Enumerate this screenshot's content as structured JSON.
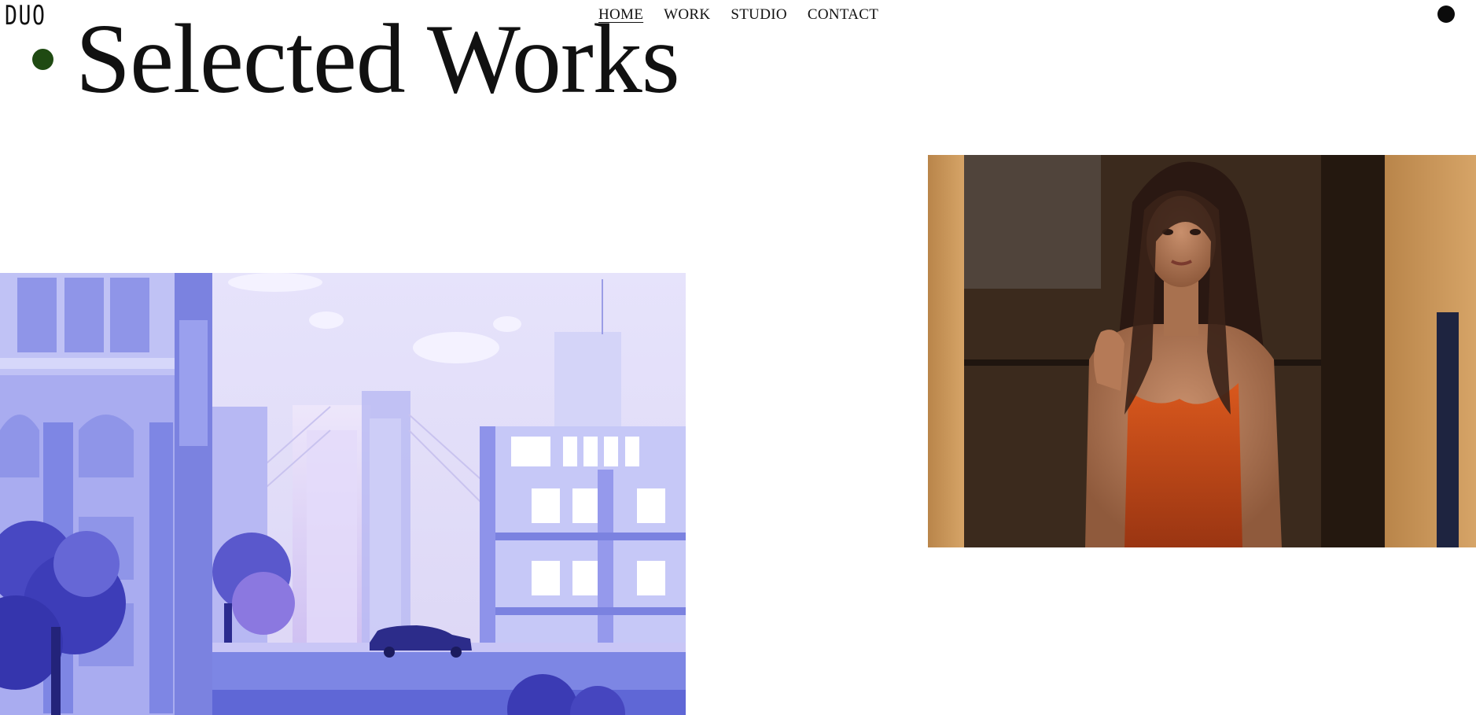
{
  "brand": {
    "logo_text": "DUO"
  },
  "nav": {
    "items": [
      {
        "label": "HOME",
        "active": true
      },
      {
        "label": "WORK",
        "active": false
      },
      {
        "label": "STUDIO",
        "active": false
      },
      {
        "label": "CONTACT",
        "active": false
      }
    ]
  },
  "page": {
    "title": "Selected Works"
  },
  "colors": {
    "accent_dot": "#1f4a12",
    "text": "#111111",
    "background": "#ffffff"
  },
  "works": [
    {
      "kind": "illustration",
      "icon": "city-bridge-illustration"
    },
    {
      "kind": "photo",
      "icon": "portrait-photo"
    }
  ]
}
